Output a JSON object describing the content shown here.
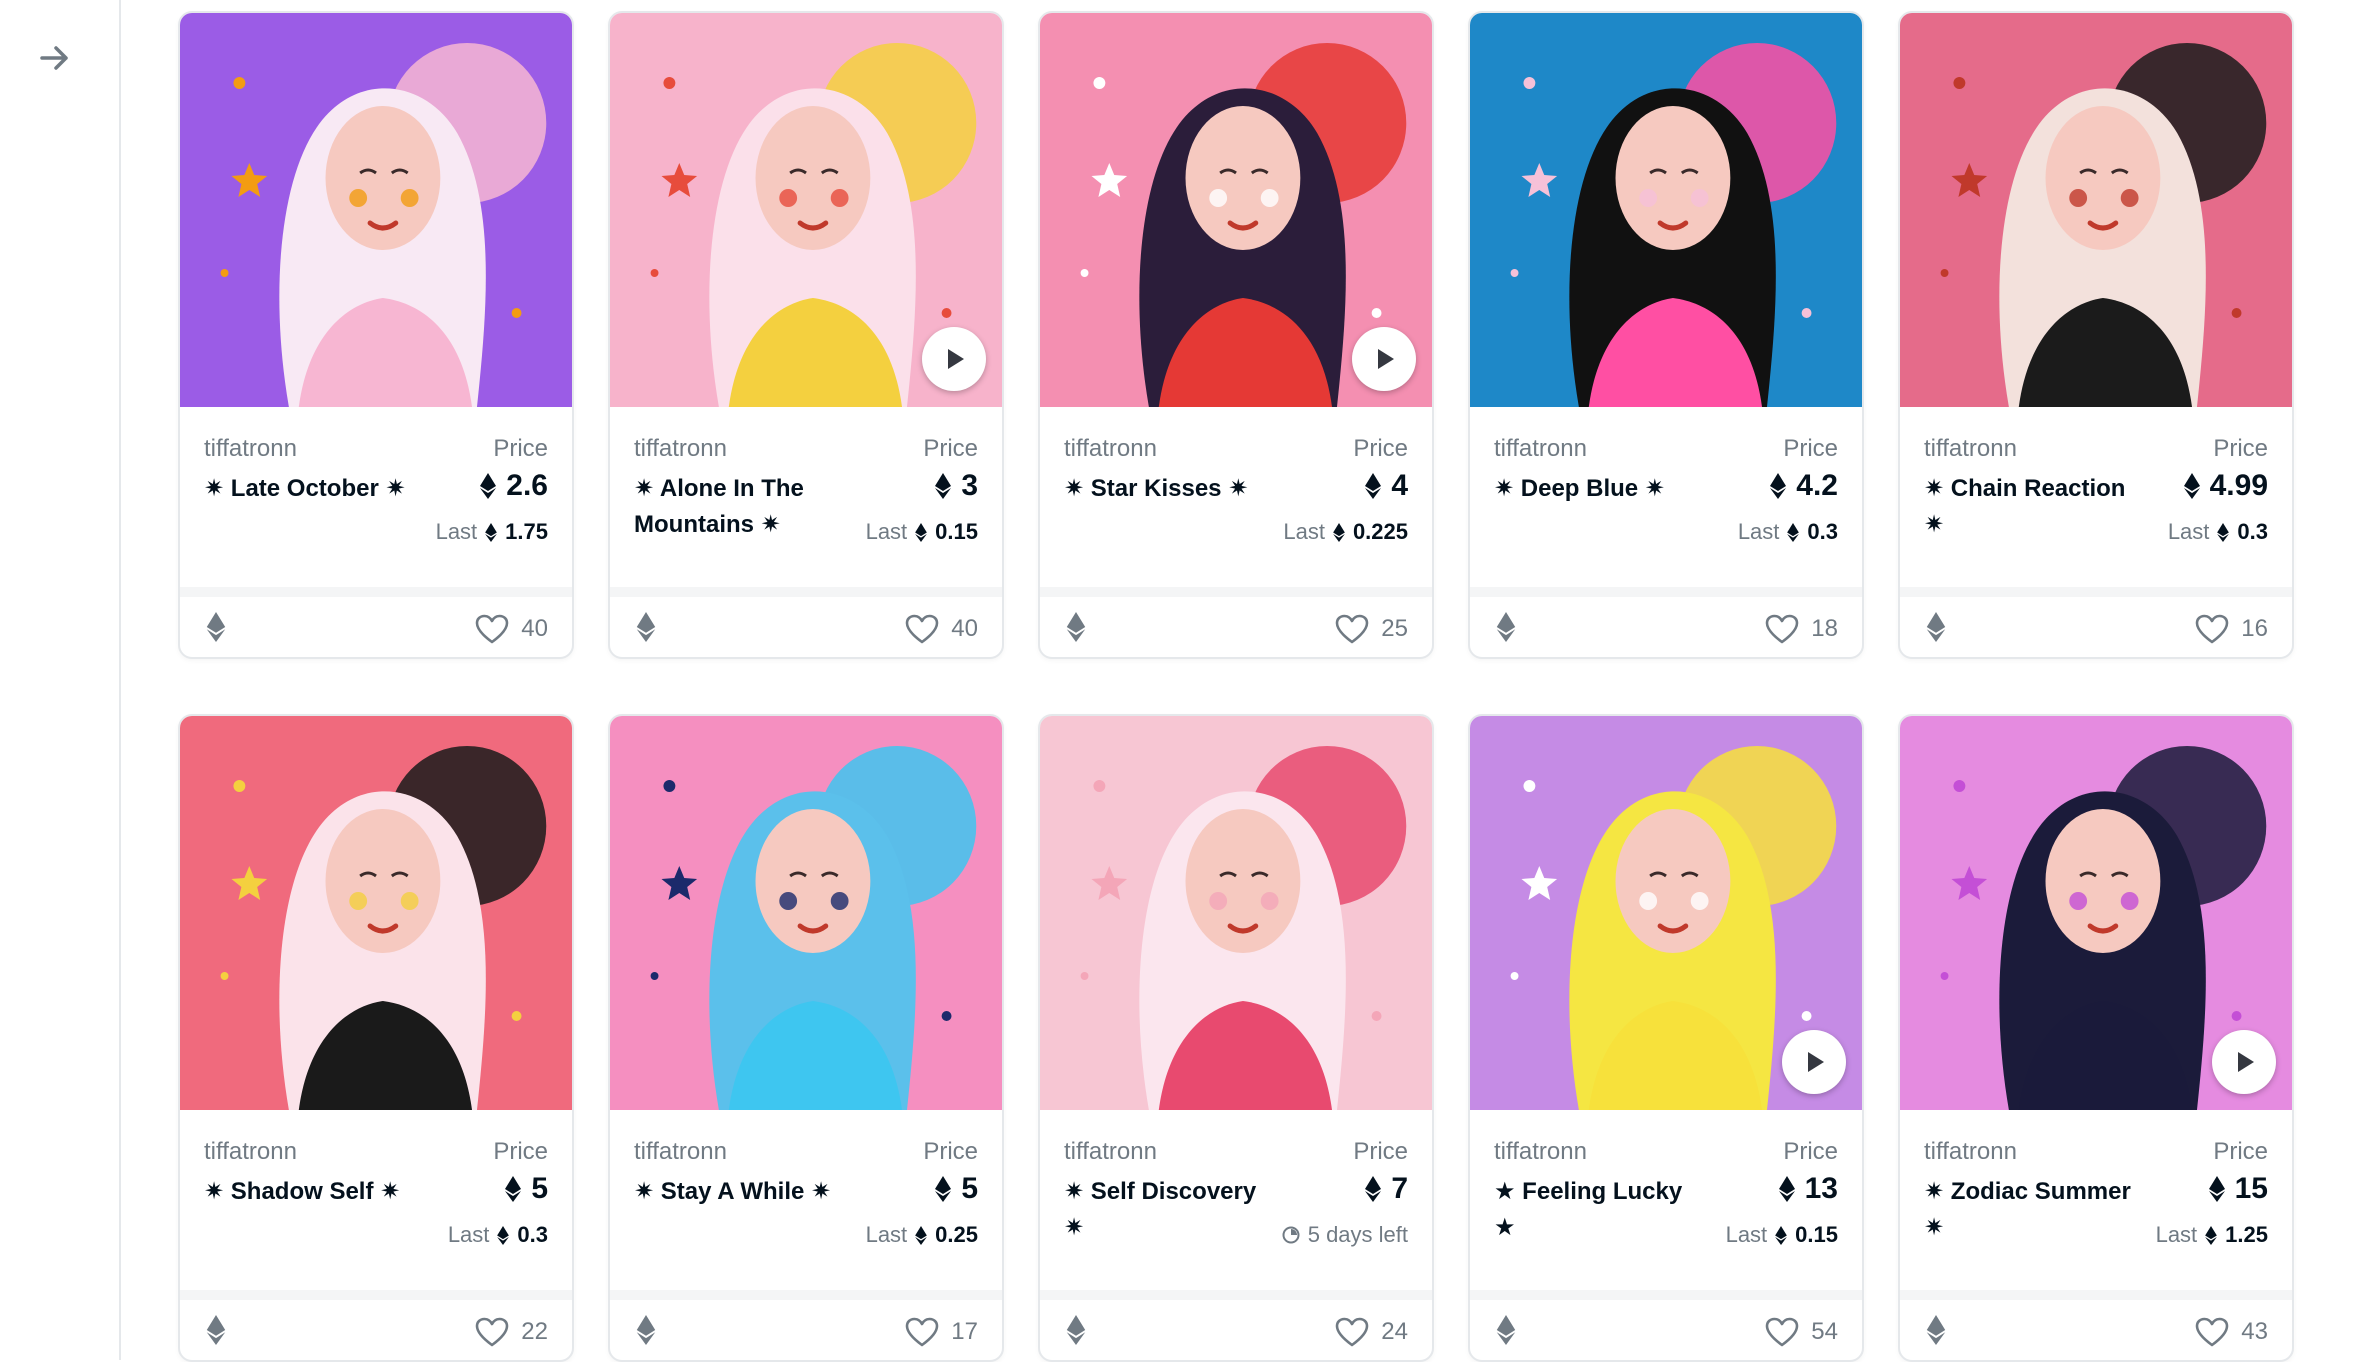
{
  "sidebar": {
    "toggle_icon": "arrow-right-icon"
  },
  "cards": [
    {
      "collection": "tiffatronn",
      "title": "✷ Late October ✷",
      "price_label": "Price",
      "price": "2.6",
      "last_label": "Last",
      "last": "1.75",
      "likes": "40",
      "video": false,
      "palette": {
        "bg": "#9b5ce6",
        "accent": "#f7b6d2",
        "hair": "#f8e9f4",
        "detail": "#f39c12"
      }
    },
    {
      "collection": "tiffatronn",
      "title": "✷ Alone In The Mountains ✷",
      "price_label": "Price",
      "price": "3",
      "last_label": "Last",
      "last": "0.15",
      "likes": "40",
      "video": true,
      "palette": {
        "bg": "#f7b3cb",
        "accent": "#f4d03f",
        "hair": "#fbe0ea",
        "detail": "#e74c3c"
      }
    },
    {
      "collection": "tiffatronn",
      "title": "✷ Star Kisses ✷",
      "price_label": "Price",
      "price": "4",
      "last_label": "Last",
      "last": "0.225",
      "likes": "25",
      "video": true,
      "palette": {
        "bg": "#f48fb1",
        "accent": "#e53935",
        "hair": "#2b1d3a",
        "detail": "#ffffff"
      }
    },
    {
      "collection": "tiffatronn",
      "title": "✷ Deep Blue ✷",
      "price_label": "Price",
      "price": "4.2",
      "last_label": "Last",
      "last": "0.3",
      "likes": "18",
      "video": false,
      "palette": {
        "bg": "#1e88c8",
        "accent": "#ff4fa3",
        "hair": "#111111",
        "detail": "#f6c1d8"
      }
    },
    {
      "collection": "tiffatronn",
      "title": "✷ Chain Reaction ✷",
      "price_label": "Price",
      "price": "4.99",
      "last_label": "Last",
      "last": "0.3",
      "likes": "16",
      "video": false,
      "palette": {
        "bg": "#e56b8a",
        "accent": "#1b1b1b",
        "hair": "#f3e1dc",
        "detail": "#c0392b"
      }
    },
    {
      "collection": "tiffatronn",
      "title": "✷ Shadow Self ✷",
      "price_label": "Price",
      "price": "5",
      "last_label": "Last",
      "last": "0.3",
      "likes": "22",
      "video": false,
      "palette": {
        "bg": "#f06a7d",
        "accent": "#1a1a1a",
        "hair": "#fbe3ea",
        "detail": "#f4d03f"
      }
    },
    {
      "collection": "tiffatronn",
      "title": "✷ Stay A While ✷",
      "price_label": "Price",
      "price": "5",
      "last_label": "Last",
      "last": "0.25",
      "likes": "17",
      "video": false,
      "palette": {
        "bg": "#f58fc0",
        "accent": "#3ec6f0",
        "hair": "#5bc0eb",
        "detail": "#1b2a6b"
      }
    },
    {
      "collection": "tiffatronn",
      "title": "✷ Self Discovery ✷",
      "price_label": "Price",
      "price": "7",
      "last_label": "",
      "last": "5 days left",
      "likes": "24",
      "video": false,
      "timer": true,
      "palette": {
        "bg": "#f7c6d3",
        "accent": "#e84a6f",
        "hair": "#fbe6ee",
        "detail": "#f4a6b8"
      }
    },
    {
      "collection": "tiffatronn",
      "title": "★ Feeling Lucky ★",
      "price_label": "Price",
      "price": "13",
      "last_label": "Last",
      "last": "0.15",
      "likes": "54",
      "video": true,
      "palette": {
        "bg": "#c58be5",
        "accent": "#f7e13b",
        "hair": "#f5e642",
        "detail": "#ffffff"
      }
    },
    {
      "collection": "tiffatronn",
      "title": "✷ Zodiac Summer ✷",
      "price_label": "Price",
      "price": "15",
      "last_label": "Last",
      "last": "1.25",
      "likes": "43",
      "video": true,
      "palette": {
        "bg": "#e58be0",
        "accent": "#1a1a3a",
        "hair": "#1b1b3a",
        "detail": "#c44fd6"
      }
    }
  ]
}
